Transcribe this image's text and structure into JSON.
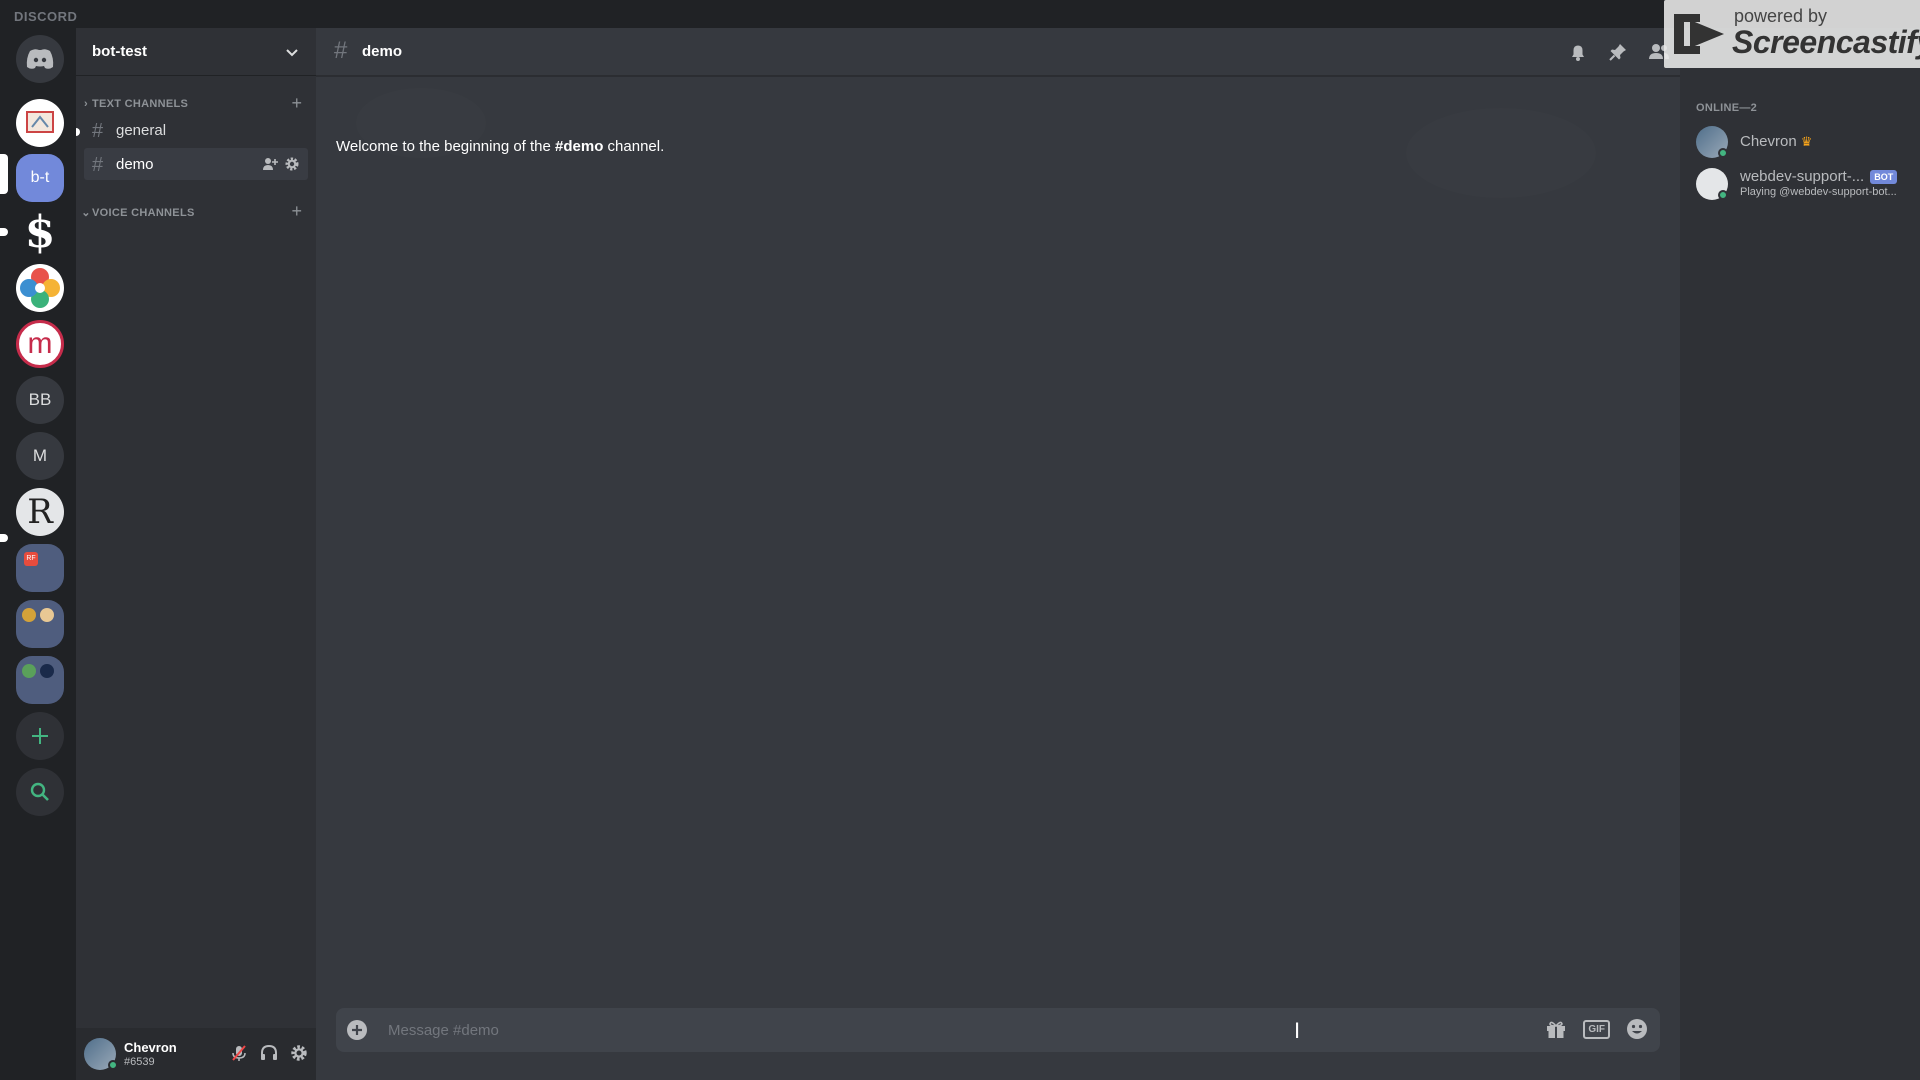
{
  "titlebar": {
    "brand": "DISCORD"
  },
  "servers": [
    {
      "label": "",
      "kind": "home"
    },
    {
      "label": "",
      "kind": "image"
    },
    {
      "label": "b-t",
      "kind": "selected"
    },
    {
      "label": "$",
      "kind": "dollar"
    },
    {
      "label": "",
      "kind": "pinwheel"
    },
    {
      "label": "m",
      "kind": "m-logo"
    },
    {
      "label": "BB",
      "kind": "text"
    },
    {
      "label": "M",
      "kind": "text"
    },
    {
      "label": "R",
      "kind": "r-logo"
    },
    {
      "label": "RF",
      "kind": "folder"
    },
    {
      "label": "",
      "kind": "folder"
    },
    {
      "label": "",
      "kind": "folder"
    }
  ],
  "guild": {
    "name": "bot-test"
  },
  "categories": {
    "text": "TEXT CHANNELS",
    "voice": "VOICE CHANNELS"
  },
  "channels": [
    {
      "name": "general"
    },
    {
      "name": "demo"
    }
  ],
  "user": {
    "name": "Chevron",
    "tag": "#6539"
  },
  "chat": {
    "channel": "demo",
    "welcome_prefix": "Welcome to the beginning of the ",
    "welcome_channel": "#demo",
    "welcome_suffix": " channel.",
    "composer_placeholder": "Message #demo",
    "gif_label": "GIF"
  },
  "members": {
    "header": "ONLINE—2",
    "list": [
      {
        "name": "Chevron",
        "game": ""
      },
      {
        "name": "webdev-support-...",
        "tag": "BOT",
        "game": "Playing @webdev-support-bot..."
      }
    ]
  },
  "watermark": {
    "small": "powered by",
    "big": "Screencastify"
  },
  "colors": {
    "accent": "#7289da",
    "online": "#43b581",
    "bg": "#36393f",
    "sidebar": "#2f3136",
    "rail": "#202225"
  }
}
